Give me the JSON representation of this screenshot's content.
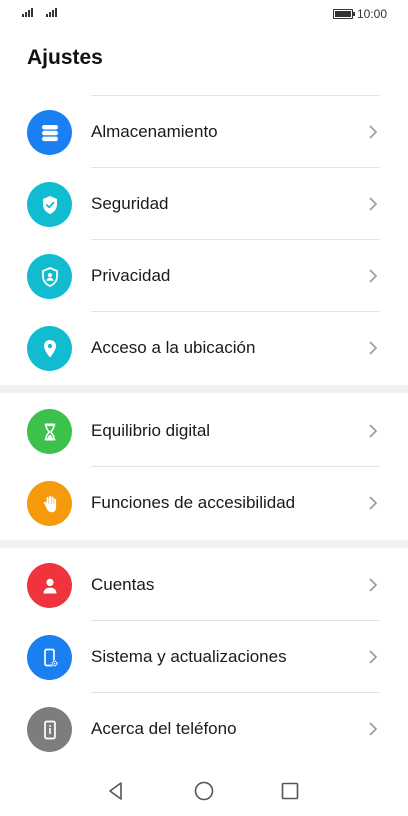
{
  "status_bar": {
    "time": "10:00"
  },
  "page": {
    "title": "Ajustes"
  },
  "settings": {
    "almacenamiento": {
      "label": "Almacenamiento",
      "color": "#1a7ff0"
    },
    "seguridad": {
      "label": "Seguridad",
      "color": "#12bcd0"
    },
    "privacidad": {
      "label": "Privacidad",
      "color": "#12bcd0"
    },
    "ubicacion": {
      "label": "Acceso a la ubicación",
      "color": "#12bcd0"
    },
    "equilibrio": {
      "label": "Equilibrio digital",
      "color": "#3cc24a"
    },
    "accesibilidad": {
      "label": "Funciones de accesibilidad",
      "color": "#f59a0a"
    },
    "cuentas": {
      "label": "Cuentas",
      "color": "#f0343e"
    },
    "sistema": {
      "label": "Sistema y actualizaciones",
      "color": "#1a7ff0"
    },
    "acerca": {
      "label": "Acerca del teléfono",
      "color": "#7d7d7d"
    }
  },
  "icons": {
    "signal": "signal-icon",
    "battery": "battery-icon",
    "chevron": "chevron-right-icon",
    "nav_back": "back-triangle-icon",
    "nav_home": "home-circle-icon",
    "nav_recents": "recents-square-icon"
  }
}
